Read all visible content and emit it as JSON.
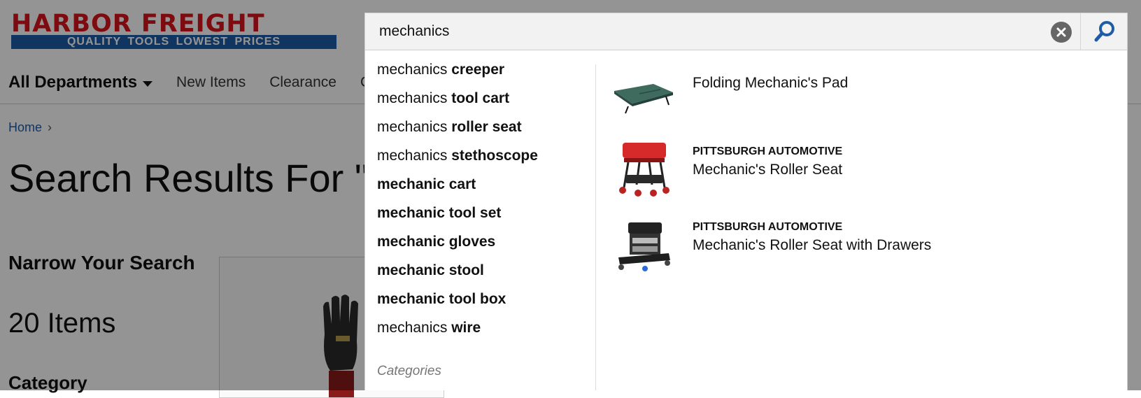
{
  "header": {
    "logo_top": "HARBOR FREIGHT",
    "logo_tagline": "QUALITY TOOLS   LOWEST PRICES",
    "colors": {
      "brand_red": "#d7141a",
      "brand_blue": "#1e5ca8"
    }
  },
  "nav": {
    "all_departments": "All Departments",
    "links": [
      "New Items",
      "Clearance",
      "C"
    ]
  },
  "breadcrumb": {
    "home": "Home"
  },
  "results_title": "Search Results For \"M",
  "sidebar": {
    "narrow": "Narrow Your Search",
    "item_count": "20 Items",
    "category_heading": "Category"
  },
  "search": {
    "value": "mechanics",
    "clear_icon": "close-circle-icon",
    "search_icon": "magnifier-icon"
  },
  "suggestions": [
    {
      "prefix": "mechanics ",
      "bold": "creeper"
    },
    {
      "prefix": "mechanics ",
      "bold": "tool cart"
    },
    {
      "prefix": "mechanics ",
      "bold": "roller seat"
    },
    {
      "prefix": "mechanics ",
      "bold": "stethoscope"
    },
    {
      "prefix": "",
      "bold": "mechanic cart"
    },
    {
      "prefix": "",
      "bold": "mechanic tool set"
    },
    {
      "prefix": "",
      "bold": "mechanic gloves"
    },
    {
      "prefix": "",
      "bold": "mechanic stool"
    },
    {
      "prefix": "",
      "bold": "mechanic tool box"
    },
    {
      "prefix": "mechanics ",
      "bold": "wire"
    }
  ],
  "categories_label": "Categories",
  "products": [
    {
      "brand": "",
      "name": "Folding Mechanic's Pad"
    },
    {
      "brand": "PITTSBURGH AUTOMOTIVE",
      "name": "Mechanic's Roller Seat"
    },
    {
      "brand": "PITTSBURGH AUTOMOTIVE",
      "name": "Mechanic's Roller Seat with Drawers"
    }
  ]
}
